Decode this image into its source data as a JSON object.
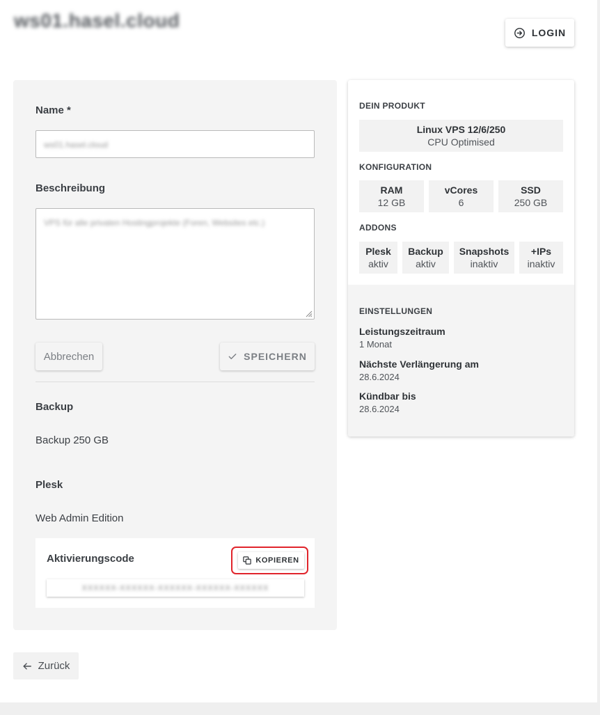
{
  "header": {
    "hostname": "ws01.hasel.cloud",
    "login_label": "LOGIN"
  },
  "form": {
    "name_label": "Name *",
    "name_value": "ws01.hasel.cloud",
    "description_label": "Beschreibung",
    "description_value": "VPS für alle privaten Hostingprojekte (Foren, Websites etc.)",
    "cancel_label": "Abbrechen",
    "save_label": "SPEICHERN"
  },
  "backup": {
    "heading": "Backup",
    "value": "Backup 250 GB"
  },
  "plesk": {
    "heading": "Plesk",
    "value": "Web Admin Edition",
    "activation_label": "Aktivierungscode",
    "copy_label": "KOPIEREN",
    "activation_code": "XXXXXX-XXXXXX-XXXXXX-XXXXXX-XXXXXX"
  },
  "back_label": "Zurück",
  "product": {
    "heading": "DEIN PRODUKT",
    "name": "Linux VPS 12/6/250",
    "subtitle": "CPU Optimised",
    "config_heading": "KONFIGURATION",
    "config": [
      {
        "label": "RAM",
        "value": "12 GB"
      },
      {
        "label": "vCores",
        "value": "6"
      },
      {
        "label": "SSD",
        "value": "250 GB"
      }
    ],
    "addons_heading": "ADDONS",
    "addons": [
      {
        "label": "Plesk",
        "value": "aktiv"
      },
      {
        "label": "Backup",
        "value": "aktiv"
      },
      {
        "label": "Snapshots",
        "value": "inaktiv"
      },
      {
        "label": "+IPs",
        "value": "inaktiv"
      }
    ]
  },
  "settings": {
    "heading": "EINSTELLUNGEN",
    "items": [
      {
        "label": "Leistungszeitraum",
        "value": "1 Monat"
      },
      {
        "label": "Nächste Verlängerung am",
        "value": "28.6.2024"
      },
      {
        "label": "Kündbar bis",
        "value": "28.6.2024"
      }
    ]
  },
  "colors": {
    "highlight": "#e0242b",
    "card_bg": "#f4f4f4"
  }
}
